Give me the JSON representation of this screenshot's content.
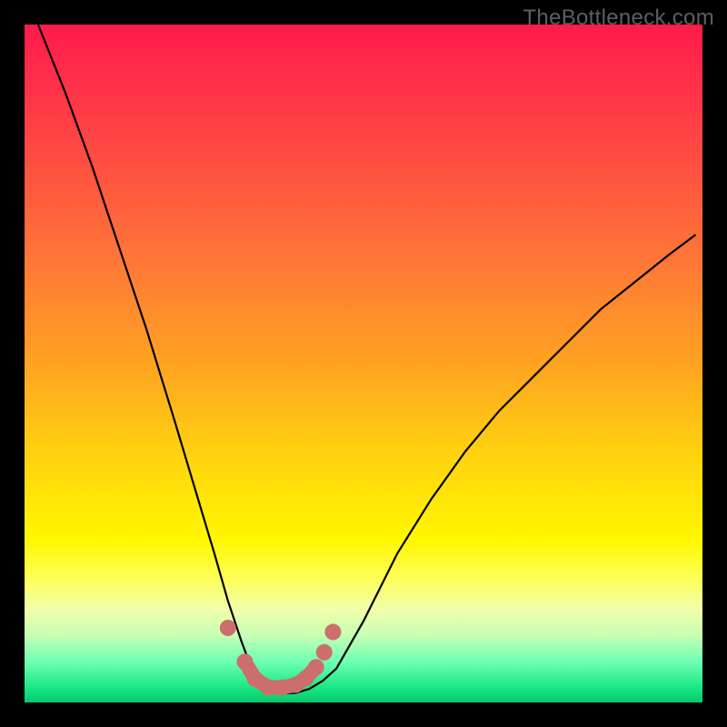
{
  "watermark": "TheBottleneck.com",
  "chart_data": {
    "type": "line",
    "title": "",
    "xlabel": "",
    "ylabel": "",
    "xlim": [
      0,
      100
    ],
    "ylim": [
      0,
      100
    ],
    "grid": false,
    "series": [
      {
        "name": "curve",
        "type": "line",
        "color": "#000000",
        "x": [
          2,
          6,
          10,
          14,
          18,
          22,
          25,
          28,
          30,
          32,
          33.5,
          35,
          36,
          37,
          38,
          40,
          42,
          44,
          46,
          50,
          55,
          60,
          65,
          70,
          75,
          80,
          85,
          90,
          95,
          99
        ],
        "y": [
          100,
          90,
          79,
          67,
          55,
          42,
          32,
          22,
          15,
          9,
          5,
          3,
          2,
          1.5,
          1.3,
          1.4,
          2,
          3.2,
          5,
          12,
          22,
          30,
          37,
          43,
          48,
          53,
          58,
          62,
          66,
          69
        ]
      },
      {
        "name": "markers",
        "type": "scatter",
        "color": "#cc6f6c",
        "x": [
          30,
          32.5,
          34,
          36,
          38,
          40,
          41.5,
          43,
          44.2,
          45.5
        ],
        "y": [
          11,
          6,
          3.5,
          2.2,
          2.2,
          2.6,
          3.6,
          5.2,
          7.4,
          10.4
        ]
      },
      {
        "name": "thick-segment",
        "type": "line",
        "color": "#cc6f6c",
        "width": 16,
        "x": [
          32.5,
          34,
          36,
          38,
          40,
          41.5,
          43
        ],
        "y": [
          6,
          3.5,
          2.2,
          2.2,
          2.6,
          3.6,
          5.2
        ]
      }
    ],
    "background_gradient": {
      "top": "#ff1b4a",
      "mid": "#ffd40f",
      "bottom": "#06c86d"
    }
  }
}
